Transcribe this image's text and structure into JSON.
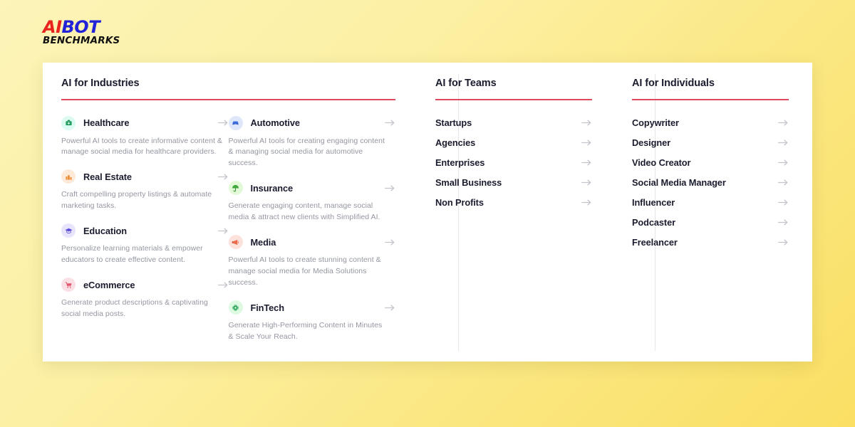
{
  "logo": {
    "part_ai": "AI",
    "part_bot": "BOT",
    "part_benchmarks": "BENCHMARKS",
    "color_ai": "#E8241C",
    "color_bot": "#2222D8",
    "color_benchmarks": "#111111"
  },
  "theme": {
    "background_start": "#FCF4B8",
    "background_end": "#FADF63",
    "panel_background": "#FFFFFF",
    "accent_rule": "#E0495D",
    "heading_color": "#1A1C2E",
    "description_color": "#9497A1",
    "arrow_color": "#C3C5CC",
    "divider_color": "#E7E7EA"
  },
  "menu": {
    "industries": {
      "title": "AI for Industries",
      "column_left": [
        {
          "label": "Healthcare",
          "description": "Powerful AI tools to create informative content & manage social media for healthcare providers.",
          "icon": "medical-bag-icon",
          "icon_glyph": "🩹",
          "icon_bg": "#DCFBF2"
        },
        {
          "label": "Real Estate",
          "description": "Craft compelling property listings & automate marketing tasks.",
          "icon": "building-icon",
          "icon_glyph": "🏢",
          "icon_bg": "#FDEAD8"
        },
        {
          "label": "Education",
          "description": "Personalize learning materials & empower educators to create effective content.",
          "icon": "graduation-cap-icon",
          "icon_glyph": "🎓",
          "icon_bg": "#E7E4FB"
        },
        {
          "label": "eCommerce",
          "description": "Generate product descriptions & captivating social media posts.",
          "icon": "shopping-cart-icon",
          "icon_glyph": "🛒",
          "icon_bg": "#FBE0E6"
        }
      ],
      "column_right": [
        {
          "label": "Automotive",
          "description": "Powerful AI tools for creating engaging content & managing social media for automotive success.",
          "icon": "car-icon",
          "icon_glyph": "🚗",
          "icon_bg": "#DFE8FB"
        },
        {
          "label": "Insurance",
          "description": "Generate engaging content, manage social media & attract new clients with Simplified AI.",
          "icon": "umbrella-icon",
          "icon_glyph": "☔",
          "icon_bg": "#E3FAD9"
        },
        {
          "label": "Media",
          "description": "Powerful AI tools to create stunning content & manage social media for Media Solutions success.",
          "icon": "megaphone-icon",
          "icon_glyph": "📣",
          "icon_bg": "#FDE2DC"
        },
        {
          "label": "FinTech",
          "description": "Generate High-Performing Content in Minutes & Scale Your Reach.",
          "icon": "chip-icon",
          "icon_glyph": "💹",
          "icon_bg": "#DEFAE3"
        }
      ]
    },
    "teams": {
      "title": "AI for Teams",
      "items": [
        {
          "label": "Startups"
        },
        {
          "label": "Agencies"
        },
        {
          "label": "Enterprises"
        },
        {
          "label": "Small Business"
        },
        {
          "label": "Non Profits"
        }
      ]
    },
    "individuals": {
      "title": "AI for Individuals",
      "items": [
        {
          "label": "Copywriter"
        },
        {
          "label": "Designer"
        },
        {
          "label": "Video Creator"
        },
        {
          "label": "Social Media Manager"
        },
        {
          "label": "Influencer"
        },
        {
          "label": "Podcaster"
        },
        {
          "label": "Freelancer"
        }
      ]
    }
  }
}
